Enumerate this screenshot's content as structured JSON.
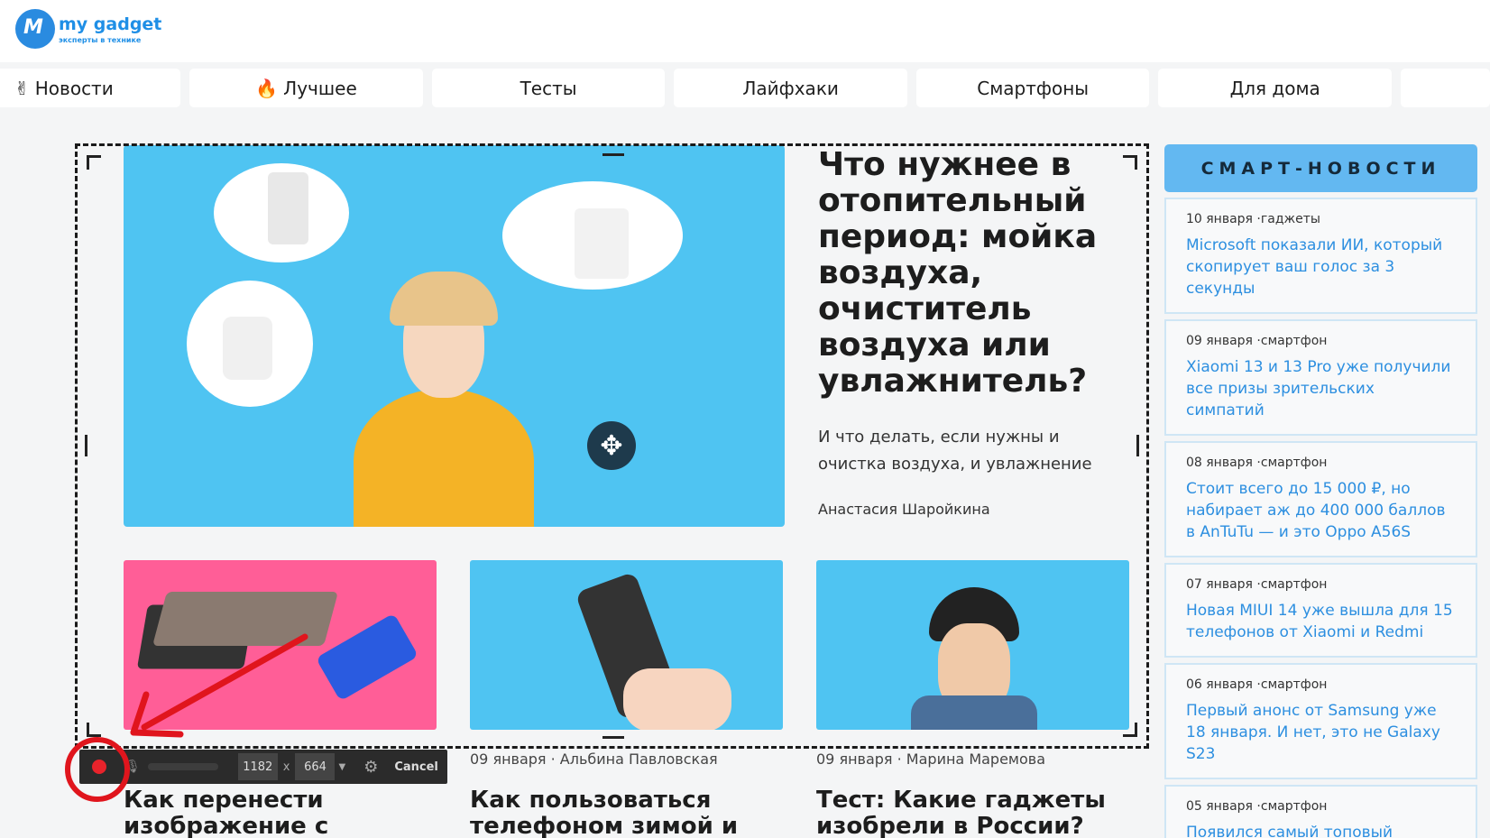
{
  "logo": {
    "name": "my gadget",
    "tagline": "эксперты в технике"
  },
  "nav": [
    {
      "label": "Новости",
      "icon": "✌"
    },
    {
      "label": "Лучшее",
      "icon": "🔥"
    },
    {
      "label": "Тесты"
    },
    {
      "label": "Лайфхаки"
    },
    {
      "label": "Смартфоны"
    },
    {
      "label": "Для дома"
    },
    {
      "label": ""
    }
  ],
  "hero": {
    "title": "Что нужнее в отопительный период: мойка воздуха, очиститель воздуха или увлажнитель?",
    "subtitle": "И что делать, если нужны и очистка воздуха, и увлажнение",
    "author": "Анастасия Шаройкина"
  },
  "cards": [
    {
      "meta": "",
      "title": "Как перенести изображение с"
    },
    {
      "meta": "09 января · Альбина Павловская",
      "title": "Как пользоваться телефоном зимой и"
    },
    {
      "meta": "09 января · Марина Маремова",
      "title": "Тест: Какие гаджеты изобрели в России?"
    }
  ],
  "recorder": {
    "width": "1182",
    "x_sep": "x",
    "height": "664",
    "cancel": "Cancel"
  },
  "sidebar": {
    "heading": "СМАРТ-НОВОСТИ",
    "items": [
      {
        "meta": "10 января ·гаджеты",
        "title": "Microsoft показали ИИ, который скопирует ваш голос за 3 секунды"
      },
      {
        "meta": "09 января ·смартфон",
        "title": "Xiaomi 13 и 13 Pro уже получили все призы зрительских симпатий"
      },
      {
        "meta": "08 января ·смартфон",
        "title": "Стоит всего до 15 000 ₽, но набирает аж до 400 000 баллов в AnTuTu — и это Oppo A56S"
      },
      {
        "meta": "07 января ·смартфон",
        "title": "Новая MIUI 14 уже вышла для 15 телефонов от Xiaomi и Redmi"
      },
      {
        "meta": "06 января ·смартфон",
        "title": "Первый анонс от Samsung уже 18 января. И нет, это не Galaxy S23"
      },
      {
        "meta": "05 января ·смартфон",
        "title": "Появился самый топовый"
      }
    ]
  },
  "colors": {
    "accent": "#2d8fe0",
    "record": "#e0151d",
    "hero_bg": "#4fc4f2",
    "card1_bg": "#ff5e97"
  }
}
